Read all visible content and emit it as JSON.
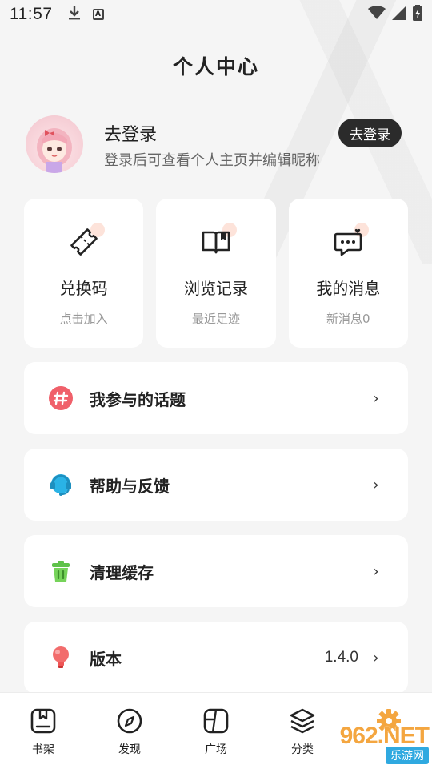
{
  "status_bar": {
    "time": "11:57",
    "a_badge": "A"
  },
  "header": {
    "title": "个人中心"
  },
  "profile": {
    "name": "去登录",
    "subtitle": "登录后可查看个人主页并编辑昵称",
    "login_button": "去登录"
  },
  "cards": [
    {
      "title": "兑换码",
      "subtitle": "点击加入",
      "icon": "ticket-icon"
    },
    {
      "title": "浏览记录",
      "subtitle": "最近足迹",
      "icon": "book-icon"
    },
    {
      "title": "我的消息",
      "subtitle": "新消息0",
      "icon": "message-icon"
    }
  ],
  "menu": [
    {
      "label": "我参与的话题",
      "icon": "hashtag-icon",
      "value": ""
    },
    {
      "label": "帮助与反馈",
      "icon": "headset-icon",
      "value": ""
    },
    {
      "label": "清理缓存",
      "icon": "trash-icon",
      "value": ""
    },
    {
      "label": "版本",
      "icon": "bulb-icon",
      "value": "1.4.0"
    }
  ],
  "bottom_nav": [
    {
      "label": "书架",
      "icon": "bookshelf-icon"
    },
    {
      "label": "发现",
      "icon": "compass-icon"
    },
    {
      "label": "广场",
      "icon": "square-icon"
    },
    {
      "label": "分类",
      "icon": "layers-icon"
    },
    {
      "label": "",
      "icon": "gear-icon"
    }
  ],
  "watermark": {
    "top": "962.NET",
    "bottom": "乐游网"
  },
  "colors": {
    "accent": "#f4a640",
    "dark_button": "#2b2b2b",
    "background": "#f5f5f5"
  }
}
